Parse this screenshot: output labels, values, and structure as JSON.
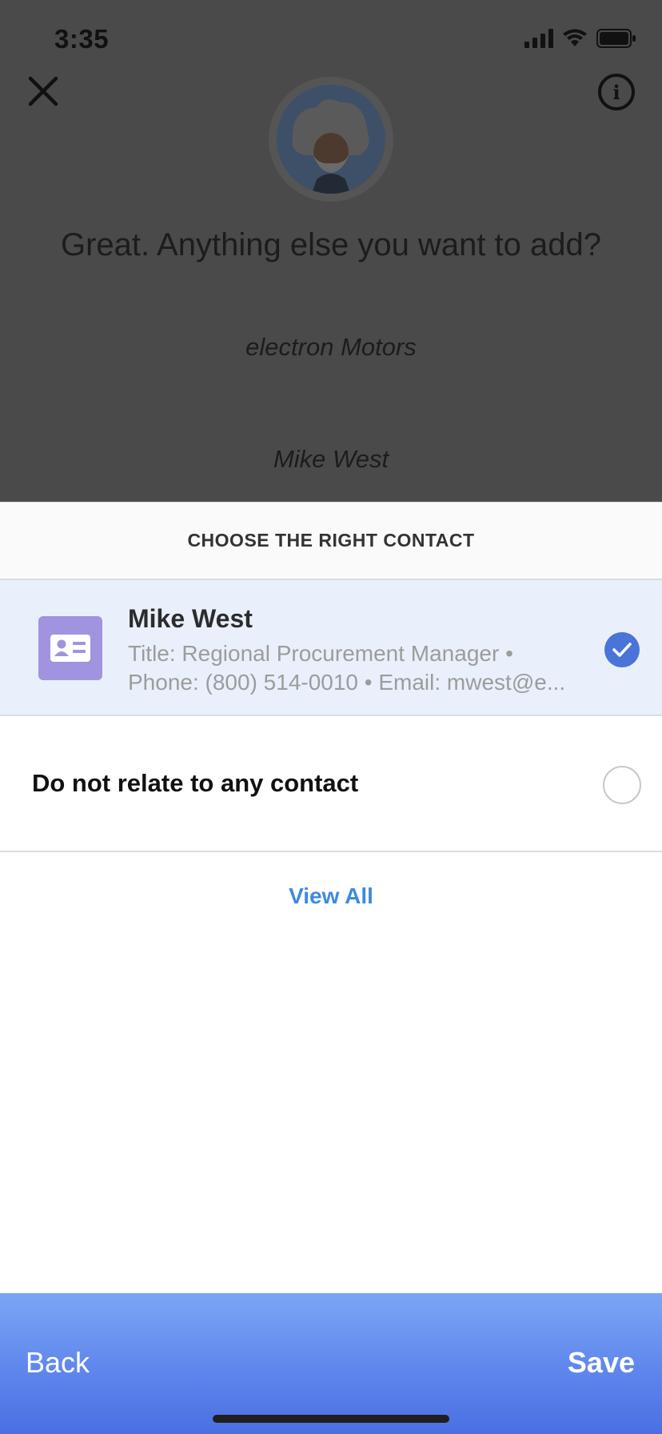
{
  "status_bar": {
    "time": "3:35"
  },
  "bot": {
    "prompt": "Great. Anything else you want to add?",
    "chips": [
      "electron Motors",
      "Mike West"
    ]
  },
  "sheet": {
    "title": "CHOOSE THE RIGHT CONTACT",
    "contact": {
      "name": "Mike West",
      "line1": "Title: Regional Procurement Manager •",
      "line2": "Phone: (800) 514-0010 • Email: mwest@e...",
      "icon": "contact-card-icon",
      "selected": true
    },
    "none_option": {
      "label": "Do not relate to any contact",
      "selected": false
    },
    "view_all": "View All"
  },
  "footer": {
    "back": "Back",
    "save": "Save"
  },
  "colors": {
    "accent": "#4a74d8",
    "link": "#3b8be0",
    "contact_icon_bg": "#a094e0",
    "selected_row_bg": "#e9f0fb",
    "footer_gradient_top": "#7aa6f6",
    "footer_gradient_bottom": "#4a6fe3"
  }
}
